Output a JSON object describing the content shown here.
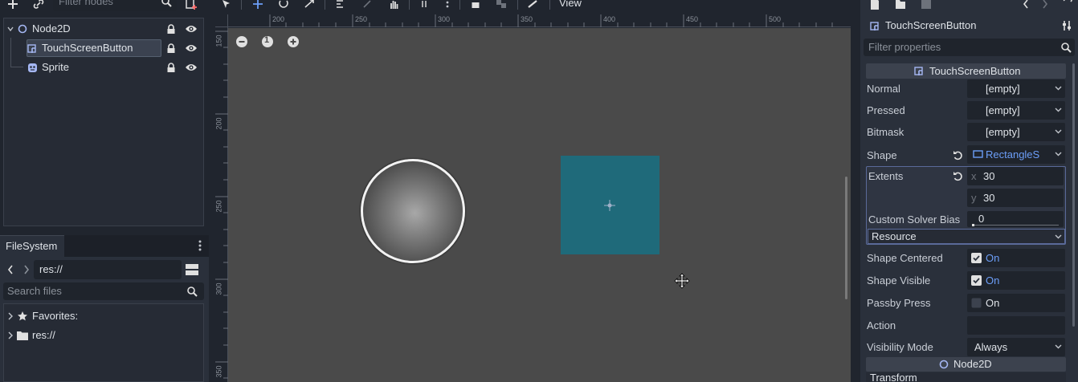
{
  "scene": {
    "filter_placeholder": "Filter nodes",
    "nodes": [
      {
        "label": "Node2D"
      },
      {
        "label": "TouchScreenButton"
      },
      {
        "label": "Sprite"
      }
    ]
  },
  "filesystem": {
    "tab": "FileSystem",
    "path": "res://",
    "search_placeholder": "Search files",
    "items": [
      {
        "label": "Favorites:"
      },
      {
        "label": "res://"
      }
    ]
  },
  "toolbar": {
    "view_menu": "View"
  },
  "ruler": {
    "h_ticks": [
      "200",
      "250",
      "300",
      "350",
      "400",
      "450",
      "500"
    ],
    "v_ticks": [
      "150",
      "200",
      "250",
      "300",
      "350"
    ]
  },
  "zoom": {
    "reset_label": "1"
  },
  "inspector": {
    "title": "TouchScreenButton",
    "filter_placeholder": "Filter properties",
    "section": "TouchScreenButton",
    "props": {
      "normal": {
        "label": "Normal",
        "value": "[empty]"
      },
      "pressed": {
        "label": "Pressed",
        "value": "[empty]"
      },
      "bitmask": {
        "label": "Bitmask",
        "value": "[empty]"
      },
      "shape": {
        "label": "Shape",
        "value": "RectangleS"
      },
      "extents": {
        "label": "Extents",
        "x_axis": "x",
        "x": "30",
        "y_axis": "y",
        "y": "30"
      },
      "solver": {
        "label": "Custom Solver Bias",
        "value": "0"
      },
      "resource": {
        "label": "Resource"
      },
      "shape_centered": {
        "label": "Shape Centered",
        "value": "On"
      },
      "shape_visible": {
        "label": "Shape Visible",
        "value": "On"
      },
      "passby": {
        "label": "Passby Press",
        "value": "On"
      },
      "action": {
        "label": "Action",
        "value": ""
      },
      "visibility": {
        "label": "Visibility Mode",
        "value": "Always"
      }
    },
    "section2": "Node2D",
    "section3": "Transform"
  },
  "colors": {
    "accent": "#6c9ef8",
    "teal_shape": "#1f6a7a",
    "bg": "#20252e"
  }
}
